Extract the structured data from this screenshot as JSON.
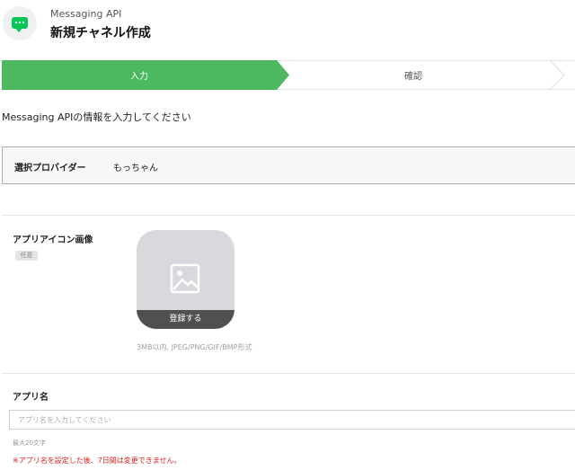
{
  "header": {
    "logo_icon": "chat-bubble-icon",
    "subtitle": "Messaging API",
    "title": "新規チャネル作成"
  },
  "steps": {
    "items": [
      {
        "label": "入力",
        "active": true
      },
      {
        "label": "確認",
        "active": false
      }
    ],
    "active_color": "#4cb85f"
  },
  "form": {
    "intro": "Messaging APIの情報を入力してください",
    "provider": {
      "label": "選択プロバイダー",
      "value": "もっちゃん"
    },
    "app_icon": {
      "label": "アプリアイコン画像",
      "badge": "任意",
      "register_label": "登録する",
      "hint": "3MB以内, JPEG/PNG/GIF/BMP形式",
      "icon": "image-placeholder-icon"
    },
    "app_name": {
      "label": "アプリ名",
      "value": "",
      "placeholder": "アプリ名を入力してください",
      "max_hint": "最大20文字",
      "warning": "※アプリ名を設定した後、7日間は変更できません。"
    }
  },
  "colors": {
    "brand_green": "#06c755",
    "warning_red": "#e02020"
  }
}
